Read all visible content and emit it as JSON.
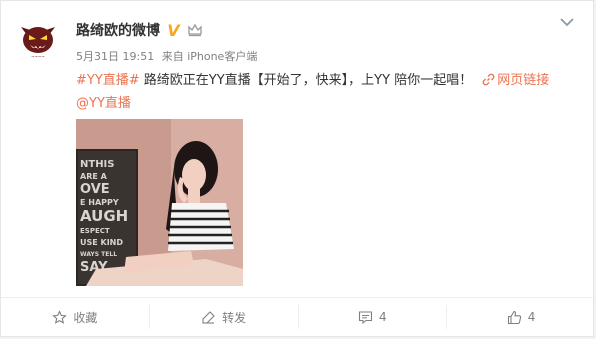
{
  "post": {
    "author": {
      "name": "路绮欧的微博",
      "verified_badge": "V"
    },
    "date": "5月31日 19:51",
    "source": "来自 iPhone客户端",
    "content": {
      "hashtag": "#YY直播#",
      "text": " 路绮欧正在YY直播【开始了，快来】，上YY 陪你一起唱！",
      "link_label": "网页链接",
      "mention": "@YY直播"
    },
    "actions": {
      "favorite_label": "收藏",
      "repost_label": "转发",
      "comment_count": "4",
      "like_count": "4"
    }
  },
  "colors": {
    "link": "#eb7350",
    "meta": "#808080",
    "badge": "#f5a623"
  },
  "icons": [
    "devil-avatar",
    "chevron-down-icon",
    "crown-icon",
    "link-icon",
    "star-icon",
    "repost-icon",
    "comment-icon",
    "thumbs-up-icon"
  ]
}
